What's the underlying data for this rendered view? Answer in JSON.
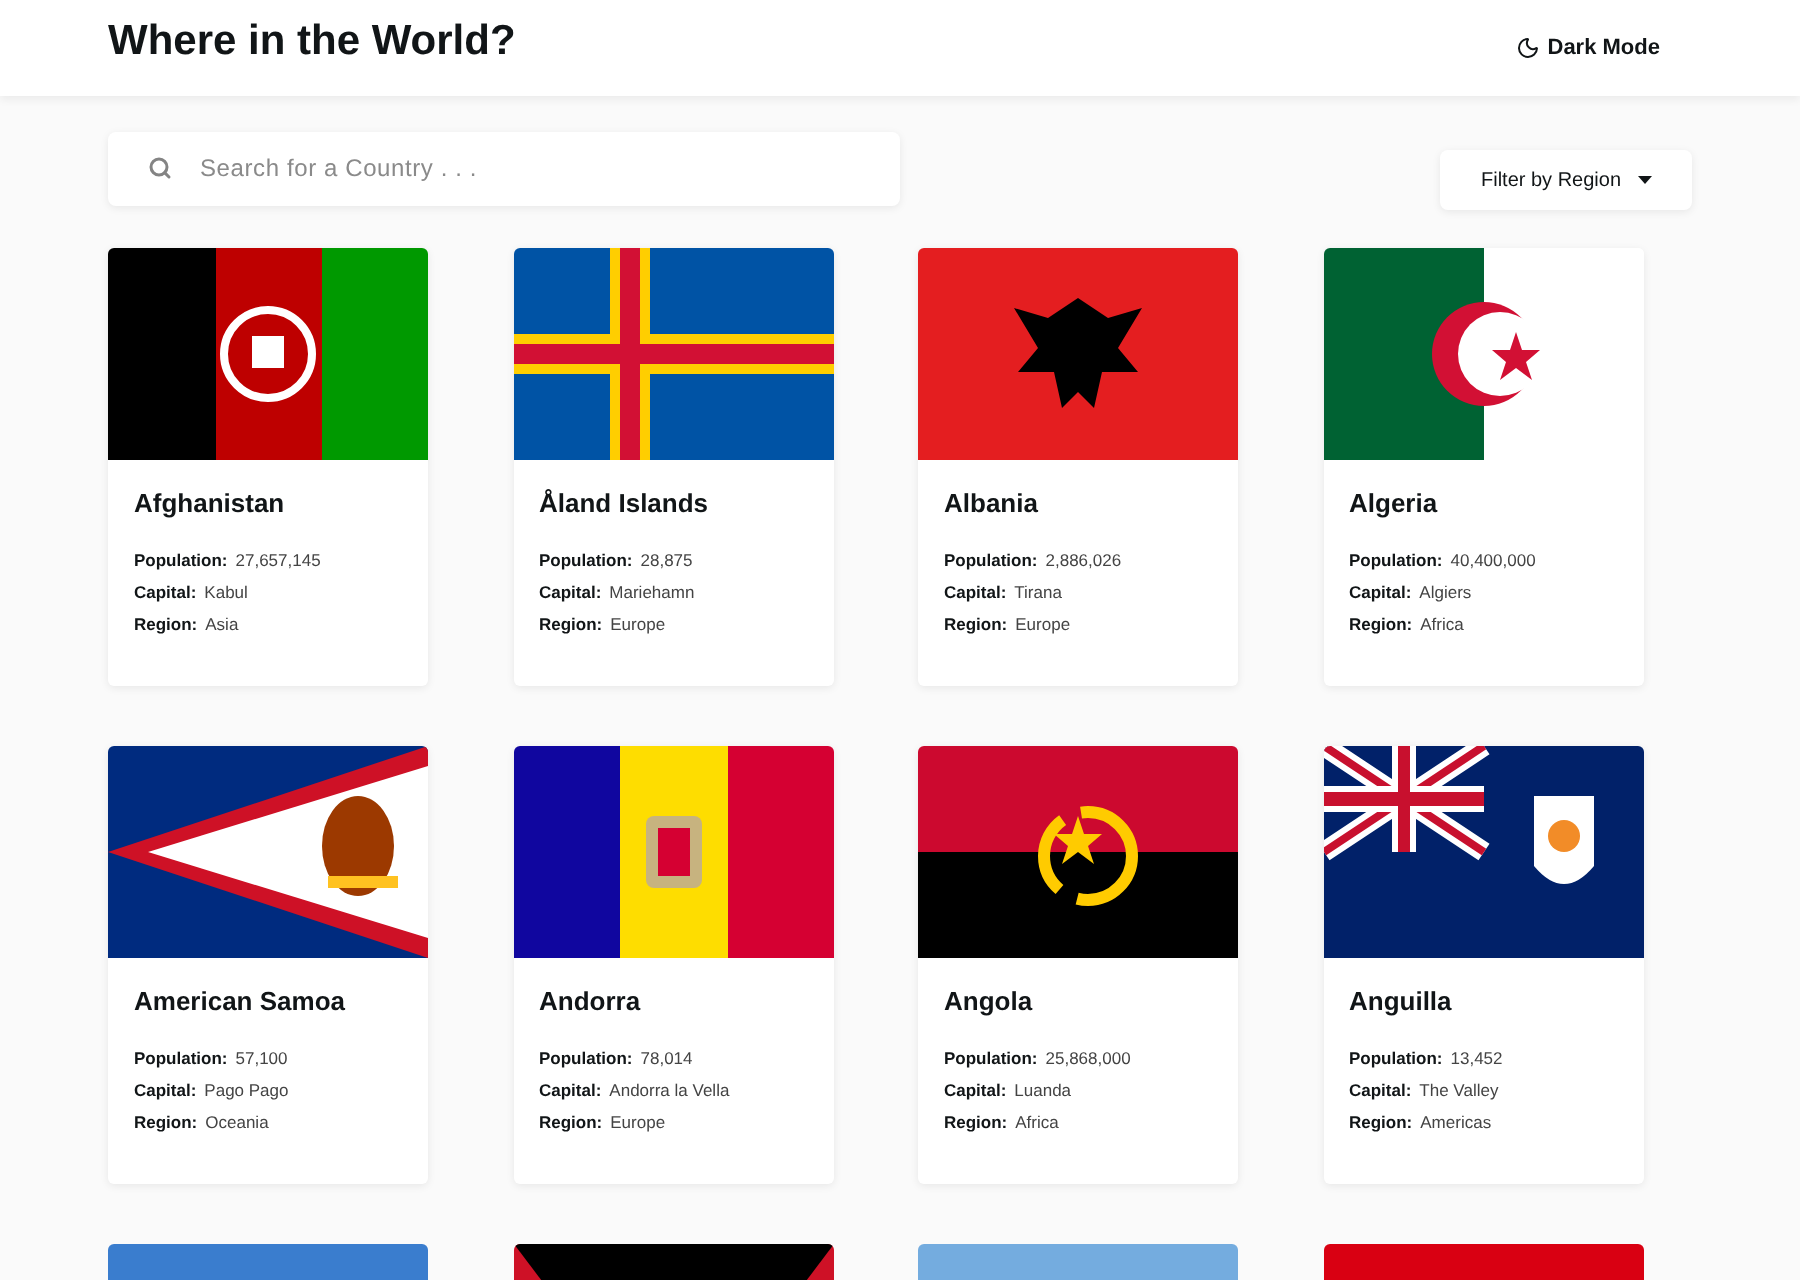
{
  "header": {
    "title": "Where in the World?",
    "theme_toggle": "Dark Mode"
  },
  "search": {
    "placeholder": "Search for a Country . . ."
  },
  "filter": {
    "label": "Filter by Region"
  },
  "countries": [
    {
      "name": "Afghanistan",
      "fields": [
        {
          "label": "Population:",
          "value": "27,657,145"
        },
        {
          "label": "Capital:",
          "value": "Kabul"
        },
        {
          "label": "Region:",
          "value": "Asia"
        }
      ]
    },
    {
      "name": "Åland Islands",
      "fields": [
        {
          "label": "Population:",
          "value": "28,875"
        },
        {
          "label": "Capital:",
          "value": "Mariehamn"
        },
        {
          "label": "Region:",
          "value": "Europe"
        }
      ]
    },
    {
      "name": "Albania",
      "fields": [
        {
          "label": "Population:",
          "value": "2,886,026"
        },
        {
          "label": "Capital:",
          "value": "Tirana"
        },
        {
          "label": "Region:",
          "value": "Europe"
        }
      ]
    },
    {
      "name": "Algeria",
      "fields": [
        {
          "label": "Population:",
          "value": "40,400,000"
        },
        {
          "label": "Capital:",
          "value": "Algiers"
        },
        {
          "label": "Region:",
          "value": "Africa"
        }
      ]
    },
    {
      "name": "American Samoa",
      "fields": [
        {
          "label": "Population:",
          "value": "57,100"
        },
        {
          "label": "Capital:",
          "value": "Pago Pago"
        },
        {
          "label": "Region:",
          "value": "Oceania"
        }
      ]
    },
    {
      "name": "Andorra",
      "fields": [
        {
          "label": "Population:",
          "value": "78,014"
        },
        {
          "label": "Capital:",
          "value": "Andorra la Vella"
        },
        {
          "label": "Region:",
          "value": "Europe"
        }
      ]
    },
    {
      "name": "Angola",
      "fields": [
        {
          "label": "Population:",
          "value": "25,868,000"
        },
        {
          "label": "Capital:",
          "value": "Luanda"
        },
        {
          "label": "Region:",
          "value": "Africa"
        }
      ]
    },
    {
      "name": "Anguilla",
      "fields": [
        {
          "label": "Population:",
          "value": "13,452"
        },
        {
          "label": "Capital:",
          "value": "The Valley"
        },
        {
          "label": "Region:",
          "value": "Americas"
        }
      ]
    }
  ]
}
